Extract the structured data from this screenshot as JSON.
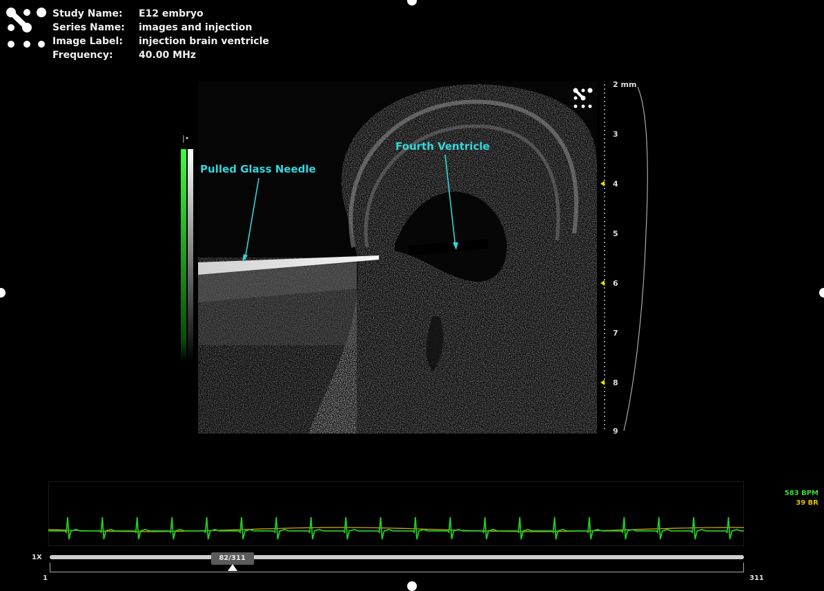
{
  "header": {
    "study_name_label": "Study Name:",
    "study_name": "E12 embryo",
    "series_name_label": "Series Name:",
    "series_name": "images and injection",
    "image_label_label": "Image Label:",
    "image_label": "injection brain ventricle",
    "frequency_label": "Frequency:",
    "frequency": "40.00 MHz"
  },
  "annotations": {
    "needle": "Pulled Glass Needle",
    "ventricle": "Fourth Ventricle"
  },
  "depth_scale": {
    "unit_first": "2 mm",
    "ticks": [
      "3",
      "4",
      "5",
      "6",
      "7",
      "8",
      "9"
    ]
  },
  "ecg": {
    "heart_rate": "583 BPM",
    "resp_rate": "39 BR",
    "colors": {
      "ecg": "#22cc22",
      "resp": "#e0b400",
      "hr_text": "#33dd33",
      "br_text": "#e0c000"
    }
  },
  "timeline": {
    "speed": "1X",
    "current_frame": "82/311",
    "progress": 0.263,
    "range_start": "1",
    "range_end": "311"
  },
  "icons": {
    "logo": "visualsonics-logo-icon",
    "view_logo": "visualsonics-small-logo-icon"
  }
}
